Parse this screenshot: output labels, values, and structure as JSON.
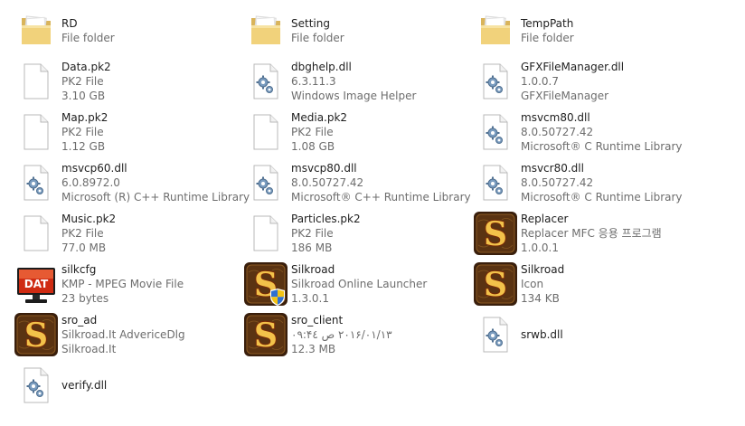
{
  "colors": {
    "folder": "#f1d27b",
    "meta_text": "#6d6d6d",
    "name_text": "#1e1e1e"
  },
  "items": [
    {
      "name": "RD",
      "lines": [
        "File folder"
      ],
      "icon": "folder-icon"
    },
    {
      "name": "Setting",
      "lines": [
        "File folder"
      ],
      "icon": "folder-icon"
    },
    {
      "name": "TempPath",
      "lines": [
        "File folder"
      ],
      "icon": "folder-icon"
    },
    {
      "name": "Data.pk2",
      "lines": [
        "PK2 File",
        "3.10 GB"
      ],
      "icon": "blank-file-icon"
    },
    {
      "name": "dbghelp.dll",
      "lines": [
        "6.3.11.3",
        "Windows Image Helper"
      ],
      "icon": "dll-gear-icon"
    },
    {
      "name": "GFXFileManager.dll",
      "lines": [
        "1.0.0.7",
        "GFXFileManager"
      ],
      "icon": "dll-gear-icon"
    },
    {
      "name": "Map.pk2",
      "lines": [
        "PK2 File",
        "1.12 GB"
      ],
      "icon": "blank-file-icon"
    },
    {
      "name": "Media.pk2",
      "lines": [
        "PK2 File",
        "1.08 GB"
      ],
      "icon": "blank-file-icon"
    },
    {
      "name": "msvcm80.dll",
      "lines": [
        "8.0.50727.42",
        "Microsoft® C Runtime Library"
      ],
      "icon": "dll-gear-icon"
    },
    {
      "name": "msvcp60.dll",
      "lines": [
        "6.0.8972.0",
        "Microsoft (R) C++ Runtime Library"
      ],
      "icon": "dll-gear-icon"
    },
    {
      "name": "msvcp80.dll",
      "lines": [
        "8.0.50727.42",
        "Microsoft® C++ Runtime Library"
      ],
      "icon": "dll-gear-icon"
    },
    {
      "name": "msvcr80.dll",
      "lines": [
        "8.0.50727.42",
        "Microsoft® C Runtime Library"
      ],
      "icon": "dll-gear-icon"
    },
    {
      "name": "Music.pk2",
      "lines": [
        "PK2 File",
        "77.0 MB"
      ],
      "icon": "blank-file-icon"
    },
    {
      "name": "Particles.pk2",
      "lines": [
        "PK2 File",
        "186 MB"
      ],
      "icon": "blank-file-icon"
    },
    {
      "name": "Replacer",
      "lines": [
        "Replacer MFC 응용 프로그램",
        "1.0.0.1"
      ],
      "icon": "silkroad-s-icon"
    },
    {
      "name": "silkcfg",
      "lines": [
        "KMP - MPEG Movie File",
        "23 bytes"
      ],
      "icon": "dat-monitor-icon"
    },
    {
      "name": "Silkroad",
      "lines": [
        "Silkroad Online Launcher",
        "1.3.0.1"
      ],
      "icon": "silkroad-shield-icon"
    },
    {
      "name": "Silkroad",
      "lines": [
        "Icon",
        "134 KB"
      ],
      "icon": "silkroad-s-icon"
    },
    {
      "name": "sro_ad",
      "lines": [
        "Silkroad.It AdvericeDlg",
        "Silkroad.It"
      ],
      "icon": "silkroad-s-icon"
    },
    {
      "name": "sro_client",
      "lines": [
        "۲۰۱۶/۰۱/۱۳ ص ۰۹:۴٤",
        "12.3 MB"
      ],
      "icon": "silkroad-s-icon"
    },
    {
      "name": "srwb.dll",
      "lines": [],
      "icon": "dll-gear-icon"
    },
    {
      "name": "verify.dll",
      "lines": [],
      "icon": "dll-gear-icon"
    }
  ]
}
